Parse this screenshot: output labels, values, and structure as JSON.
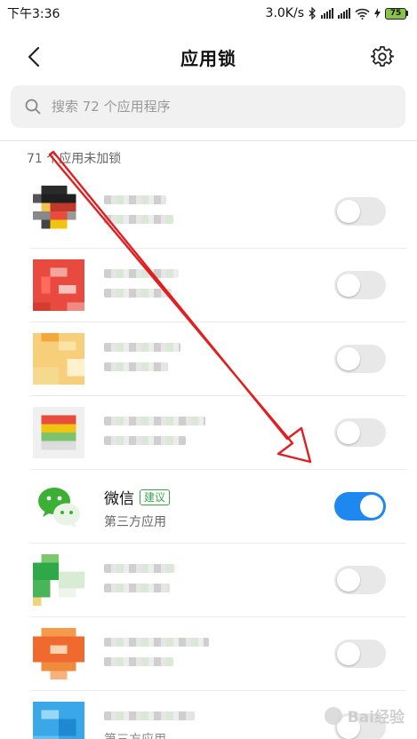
{
  "status_bar": {
    "time": "下午3:36",
    "network_speed": "3.0K/s",
    "battery_level": "75",
    "icons": [
      "bluetooth-icon",
      "signal-icon",
      "signal-icon",
      "wifi-icon",
      "charging-icon",
      "battery-icon"
    ]
  },
  "header": {
    "title": "应用锁",
    "back_icon": "chevron-left-icon",
    "settings_icon": "gear-icon"
  },
  "search": {
    "placeholder": "搜索 72 个应用程序",
    "value": "",
    "icon": "search-icon"
  },
  "section": {
    "label": "71 个应用未加锁"
  },
  "apps": [
    {
      "name": "",
      "subtitle": "",
      "locked": false,
      "blurred": true
    },
    {
      "name": "",
      "subtitle": "",
      "locked": false,
      "blurred": true
    },
    {
      "name": "",
      "subtitle": "",
      "locked": false,
      "blurred": true
    },
    {
      "name": "",
      "subtitle": "",
      "locked": false,
      "blurred": true
    },
    {
      "name": "微信",
      "badge": "建议",
      "subtitle": "第三方应用",
      "locked": true,
      "blurred": false
    },
    {
      "name": "",
      "subtitle": "",
      "locked": false,
      "blurred": true
    },
    {
      "name": "",
      "subtitle": "",
      "locked": false,
      "blurred": true
    },
    {
      "name": "",
      "subtitle": "第三方应用",
      "locked": false,
      "blurred": true
    }
  ],
  "colors": {
    "toggle_on": "#1e88f0",
    "toggle_off": "#e8e8e8",
    "badge_green": "#3aa74f",
    "annotation_arrow": "#e02020"
  },
  "watermark": {
    "text": "Bai经验"
  }
}
